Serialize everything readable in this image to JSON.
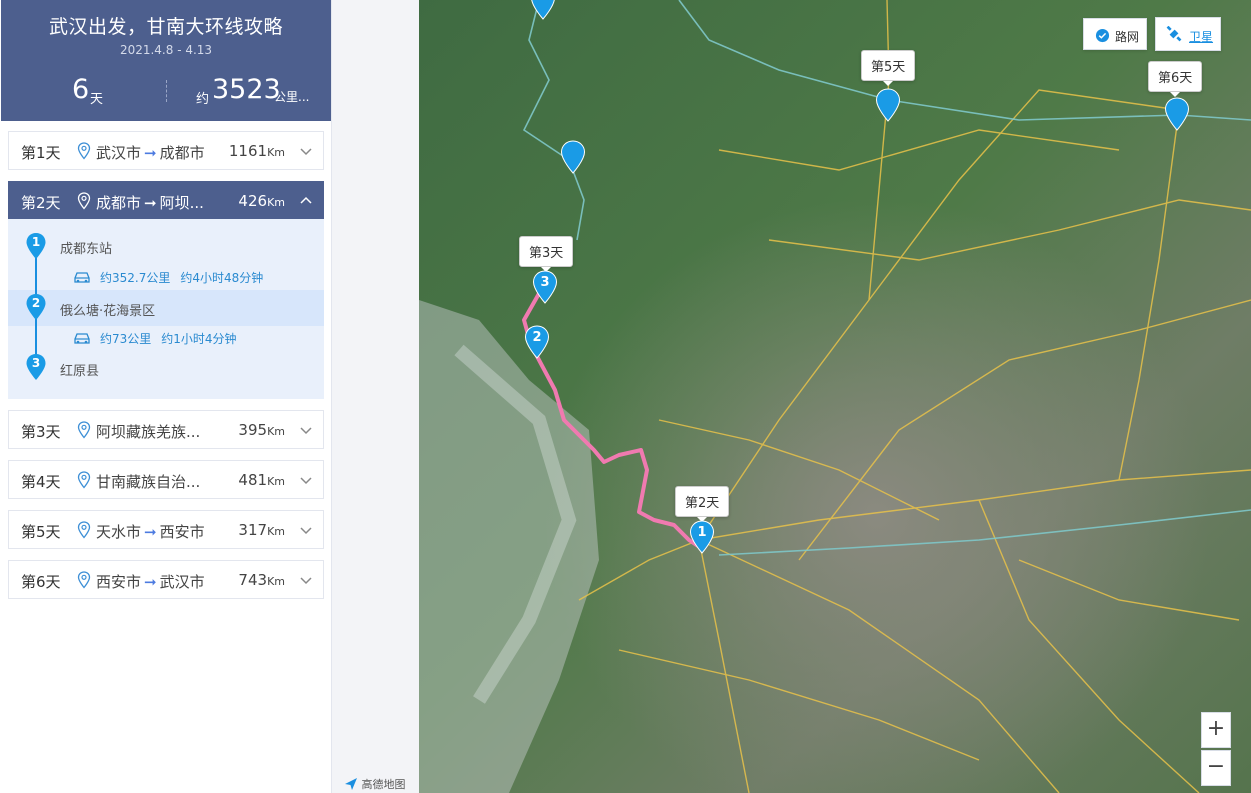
{
  "header": {
    "title": "武汉出发，甘南大环线攻略",
    "dates": "2021.4.8 - 4.13",
    "days_value": "6",
    "days_unit": "天",
    "distance_prefix": "约",
    "distance_value": "3523",
    "distance_unit": "公里..."
  },
  "days": [
    {
      "label": "第1天",
      "from": "武汉市",
      "arrow": "➞",
      "to": "成都市",
      "km": "1161",
      "km_unit": "Km"
    },
    {
      "label": "第2天",
      "from": "成都市",
      "arrow": "➞",
      "to": "阿坝...",
      "km": "426",
      "km_unit": "Km"
    },
    {
      "label": "第3天",
      "place": "阿坝藏族羌族...",
      "km": "395",
      "km_unit": "Km"
    },
    {
      "label": "第4天",
      "place": "甘南藏族自治...",
      "km": "481",
      "km_unit": "Km"
    },
    {
      "label": "第5天",
      "from": "天水市",
      "arrow": "➞",
      "to": "西安市",
      "km": "317",
      "km_unit": "Km"
    },
    {
      "label": "第6天",
      "from": "西安市",
      "arrow": "➞",
      "to": "武汉市",
      "km": "743",
      "km_unit": "Km"
    }
  ],
  "day2_detail": {
    "stops": [
      {
        "num": "1",
        "name": "成都东站"
      },
      {
        "num": "2",
        "name": "俄么塘·花海景区"
      },
      {
        "num": "3",
        "name": "红原县"
      }
    ],
    "segments": [
      {
        "distance": "约352.7公里",
        "duration": "约4小时48分钟"
      },
      {
        "distance": "约73公里",
        "duration": "约1小时4分钟"
      }
    ]
  },
  "map": {
    "controls": {
      "road": "路网",
      "satellite": "卫星"
    },
    "labels": [
      "第2天",
      "第3天",
      "第5天",
      "第6天"
    ],
    "pins": [
      "1",
      "2",
      "3"
    ],
    "zoom_in": "+",
    "zoom_out": "−",
    "logo": "高德地图",
    "colors": {
      "route": "#f07ab0",
      "pin": "#1a9be6",
      "road": "#e8c24a"
    }
  }
}
